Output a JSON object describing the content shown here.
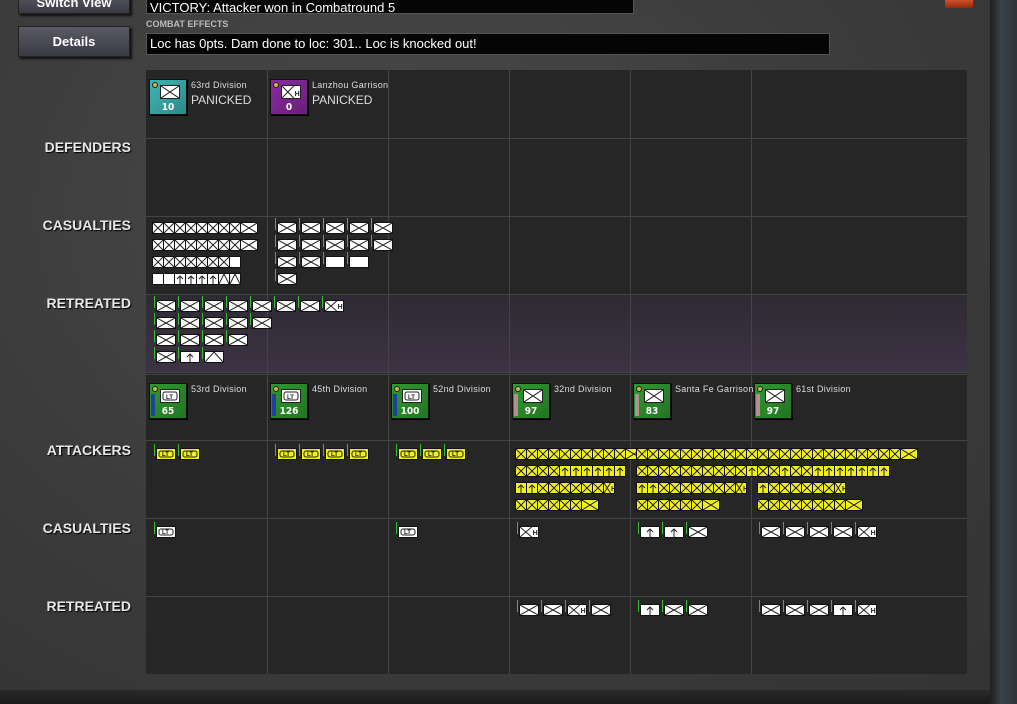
{
  "toolbar": {
    "switch_view": "Switch View",
    "details": "Details"
  },
  "result": {
    "victory": "VICTORY: Attacker won in Combatround  5",
    "effects_caption": "COMBAT EFFECTS",
    "effects": "Loc has  0pts. Dam done to loc: 301.. Loc is knocked out!"
  },
  "labels": {
    "defenders": "DEFENDERS",
    "def_casualties": "CASUALTIES",
    "def_retreated": "RETREATED",
    "attackers": "ATTACKERS",
    "att_casualties": "CASUALTIES",
    "att_retreated": "RETREATED"
  },
  "colors": {
    "defender_teal": "#3fb5b5",
    "defender_purple": "#8a2aa0",
    "attacker_green": "#2f9a2f",
    "tile_white": "#ffffff",
    "tile_yellow": "#f0f020"
  },
  "defenders": [
    {
      "name": "63rd Division",
      "status": "PANICKED",
      "value": "10",
      "color": "#3fb5b5",
      "icon": "infantry"
    },
    {
      "name": "Lanzhou Garrison",
      "status": "PANICKED",
      "value": "0",
      "color": "#8a2aa0",
      "icon": "infantry-h"
    }
  ],
  "attackers": [
    {
      "name": "53rd Division",
      "value": "65",
      "icon": "light-tank",
      "strip": "#2040a0"
    },
    {
      "name": "45th Division",
      "value": "126",
      "icon": "light-tank",
      "strip": "#2040a0"
    },
    {
      "name": "52nd Division",
      "value": "100",
      "icon": "light-tank",
      "strip": "#2040a0"
    },
    {
      "name": "32nd Division",
      "value": "97",
      "icon": "infantry",
      "strip": "#b09090"
    },
    {
      "name": "Santa Fe Garrison",
      "value": "83",
      "icon": "infantry",
      "strip": "#b09090"
    },
    {
      "name": "61st Division",
      "value": "97",
      "icon": "infantry",
      "strip": "#b09090"
    }
  ],
  "cells": {
    "def_cas_0": {
      "color": "w",
      "narrow": true,
      "rows": [
        "IIIIIIIII",
        "IIIIIIIII",
        "IIIIIIIB",
        "BBAAAATT"
      ]
    },
    "def_cas_1": {
      "color": "w",
      "rows": [
        "IIIII",
        "IIIII",
        "IIBB",
        "I"
      ]
    },
    "def_ret_0": {
      "color": "w",
      "rows": [
        "IIIIIIIH",
        "IIIII",
        "IIII",
        "IAT"
      ]
    },
    "att_0": {
      "color": "y",
      "rows": [
        "LL"
      ]
    },
    "att_1": {
      "color": "y",
      "rows": [
        "LLLL"
      ]
    },
    "att_2": {
      "color": "y",
      "rows": [
        "LLL"
      ]
    },
    "att_3": {
      "color": "y",
      "narrow": true,
      "rows": [
        "IIIIIIIIIII",
        "IIIIAAAAAA",
        "AAIIIIIIH",
        "IIIIIII"
      ]
    },
    "att_4": {
      "color": "y",
      "narrow": true,
      "rows": [
        "IIIIIIIIIIIIIIIIIIIIIIIII",
        "IIIIIIIIIIAIIAIIAAAAAAA",
        "AAIIIIIIIH",
        "IIIIIII"
      ]
    },
    "att_5": {
      "color": "y",
      "narrow": true,
      "rows": [
        "",
        "",
        "AIIIIIIH",
        "IIIIIIIII"
      ]
    },
    "attc_0": {
      "color": "w",
      "rows": [
        "L"
      ]
    },
    "attc_2": {
      "color": "w",
      "rows": [
        "L"
      ]
    },
    "attc_3": {
      "color": "w",
      "rows": [
        "H"
      ]
    },
    "attc_4": {
      "color": "w",
      "rows": [
        "AAI"
      ]
    },
    "attc_5": {
      "color": "w",
      "rows": [
        "IIIIH"
      ]
    },
    "attr_3": {
      "color": "w",
      "rows": [
        "IIHI"
      ]
    },
    "attr_4": {
      "color": "w",
      "rows": [
        "AII"
      ]
    },
    "attr_5": {
      "color": "w",
      "rows": [
        "IIIAH"
      ]
    }
  }
}
